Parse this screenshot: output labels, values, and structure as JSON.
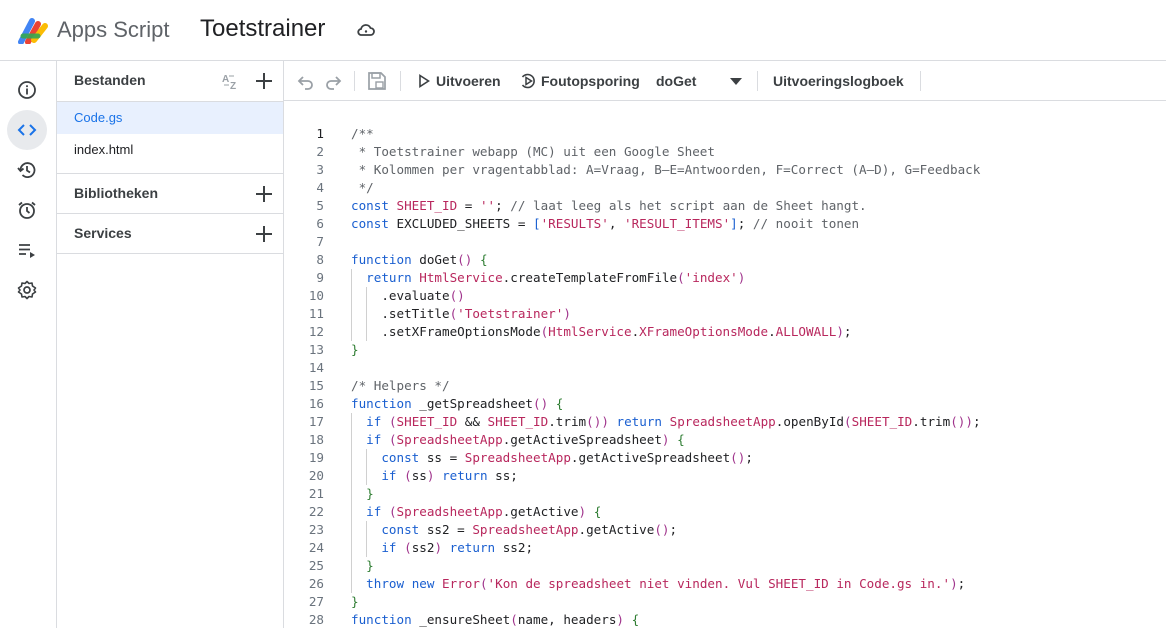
{
  "header": {
    "app_name": "Apps Script",
    "project_title": "Toetstrainer"
  },
  "rail": [
    "info-icon",
    "code-icon",
    "history-icon",
    "alarm-icon",
    "executions-icon",
    "settings-icon"
  ],
  "files_panel": {
    "title": "Bestanden",
    "files": [
      "Code.gs",
      "index.html"
    ],
    "selected_file": "Code.gs",
    "sections": [
      "Bibliotheken",
      "Services"
    ]
  },
  "toolbar": {
    "run_label": "Uitvoeren",
    "debug_label": "Foutopsporing",
    "function_select": "doGet",
    "log_label": "Uitvoeringslogboek"
  },
  "colors": {
    "accent": "#1a73e8",
    "keyword": "#1a5fd0",
    "string": "#b8275d",
    "comment": "#5f6368"
  },
  "code": {
    "current_line": 1,
    "lines": [
      "/**",
      " * Toetstrainer webapp (MC) uit een Google Sheet",
      " * Kolommen per vragentabblad: A=Vraag, B–E=Antwoorden, F=Correct (A–D), G=Feedback",
      " */",
      "const SHEET_ID = ''; // laat leeg als het script aan de Sheet hangt.",
      "const EXCLUDED_SHEETS = ['RESULTS', 'RESULT_ITEMS']; // nooit tonen",
      "",
      "function doGet() {",
      "  return HtmlService.createTemplateFromFile('index')",
      "    .evaluate()",
      "    .setTitle('Toetstrainer')",
      "    .setXFrameOptionsMode(HtmlService.XFrameOptionsMode.ALLOWALL);",
      "}",
      "",
      "/* Helpers */",
      "function _getSpreadsheet() {",
      "  if (SHEET_ID && SHEET_ID.trim()) return SpreadsheetApp.openById(SHEET_ID.trim());",
      "  if (SpreadsheetApp.getActiveSpreadsheet) {",
      "    const ss = SpreadsheetApp.getActiveSpreadsheet();",
      "    if (ss) return ss;",
      "  }",
      "  if (SpreadsheetApp.getActive) {",
      "    const ss2 = SpreadsheetApp.getActive();",
      "    if (ss2) return ss2;",
      "  }",
      "  throw new Error('Kon de spreadsheet niet vinden. Vul SHEET_ID in Code.gs in.');",
      "}",
      "function _ensureSheet(name, headers) {"
    ]
  }
}
